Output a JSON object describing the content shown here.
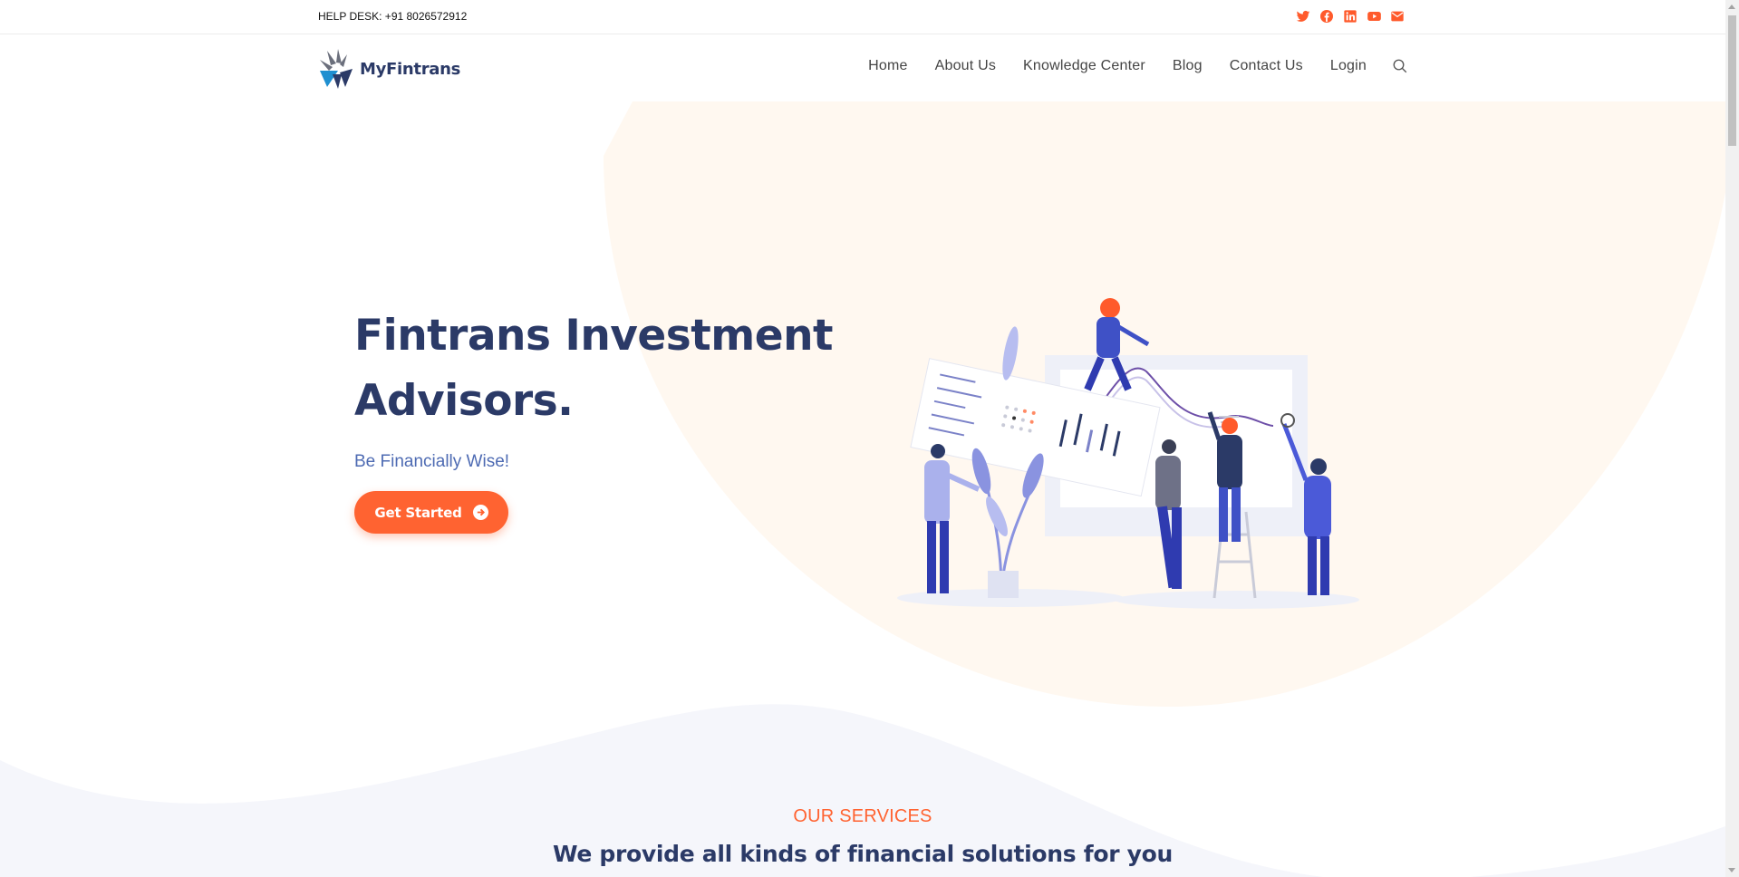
{
  "topbar": {
    "helpdesk": "HELP DESK: +91 8026572912",
    "social_icons": [
      "twitter-icon",
      "facebook-icon",
      "linkedin-icon",
      "youtube-icon",
      "email-icon"
    ],
    "icon_color": "#ff5a2b"
  },
  "header": {
    "logo_text": "MyFintrans",
    "nav": [
      "Home",
      "About Us",
      "Knowledge Center",
      "Blog",
      "Contact Us",
      "Login"
    ]
  },
  "hero": {
    "title": "Fintrans Investment Advisors.",
    "subtitle": "Be Financially Wise!",
    "cta_label": "Get Started"
  },
  "services": {
    "label": "OUR SERVICES",
    "title": "We provide all kinds of financial solutions for you"
  },
  "colors": {
    "primary": "#2b3a67",
    "accent": "#ff6331",
    "subtitle": "#4e6bb3",
    "hero_circle": "#fff7ee",
    "wave": "#f5f6fb"
  }
}
